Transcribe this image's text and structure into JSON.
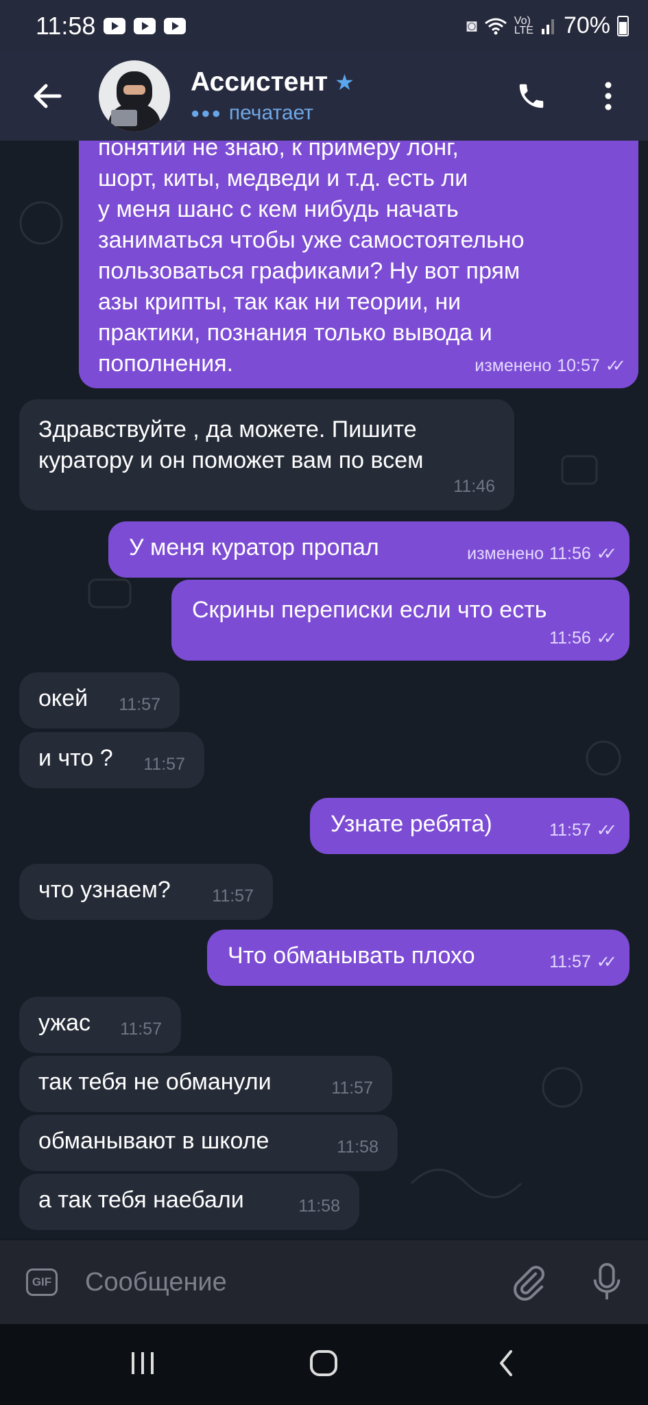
{
  "status_bar": {
    "time": "11:58",
    "battery": "70%",
    "icons": [
      "youtube-icon",
      "youtube-icon",
      "youtube-icon",
      "battery-saver-icon",
      "wifi-icon",
      "volte-icon",
      "signal-icon",
      "battery-icon"
    ]
  },
  "header": {
    "title": "Ассистент",
    "status": "печатает",
    "icons": [
      "back-arrow-icon",
      "star-icon",
      "phone-icon",
      "more-vertical-icon"
    ]
  },
  "messages": [
    {
      "dir": "out",
      "text": "понятий не знаю, к примеру лонг, шорт, киты, медведи и т.д. есть ли у меня шанс с кем нибудь начать заниматься чтобы уже самостоятельно пользоваться графиками? Ну вот прям азы крипты, так как ни теории, ни практики, познания только вывода и пополнения.",
      "edited": "изменено",
      "time": "10:57"
    },
    {
      "dir": "in",
      "text": "Здравствуйте , да можете. Пишите куратору и он поможет вам по всем",
      "time": "11:46"
    },
    {
      "dir": "out",
      "text": "У меня куратор пропал",
      "edited": "изменено",
      "time": "11:56"
    },
    {
      "dir": "out",
      "text": "Скрины переписки если что есть",
      "time": "11:56"
    },
    {
      "dir": "in",
      "text": "окей",
      "time": "11:57"
    },
    {
      "dir": "in",
      "text": "и что ?",
      "time": "11:57"
    },
    {
      "dir": "out",
      "text": "Узнате ребята)",
      "time": "11:57"
    },
    {
      "dir": "in",
      "text": "что узнаем?",
      "time": "11:57"
    },
    {
      "dir": "out",
      "text": "Что обманывать плохо",
      "time": "11:57"
    },
    {
      "dir": "in",
      "text": "ужас",
      "time": "11:57"
    },
    {
      "dir": "in",
      "text": "так тебя не обманули",
      "time": "11:57"
    },
    {
      "dir": "in",
      "text": "обманывают в школе",
      "time": "11:58"
    },
    {
      "dir": "in",
      "text": "а так тебя наебали",
      "time": "11:58"
    }
  ],
  "first_message_lines": [
    "понятий не знаю, к примеру лонг,",
    "шорт, киты, медведи и т.д. есть ли",
    "у меня шанс с кем нибудь начать",
    "заниматься чтобы уже самостоятельно",
    "пользоваться графиками? Ну вот прям",
    "азы крипты, так как ни теории, ни",
    "практики, познания только вывода и",
    "пополнения."
  ],
  "second_message_lines": [
    "Здравствуйте , да можете. Пишите",
    "куратору и он поможет вам по всем"
  ],
  "input": {
    "placeholder": "Сообщение",
    "gif_label": "GIF"
  },
  "colors": {
    "out_bubble": "#7c4cd4",
    "in_bubble": "#252b37",
    "accent": "#6fa8e6",
    "background": "#161d26"
  }
}
